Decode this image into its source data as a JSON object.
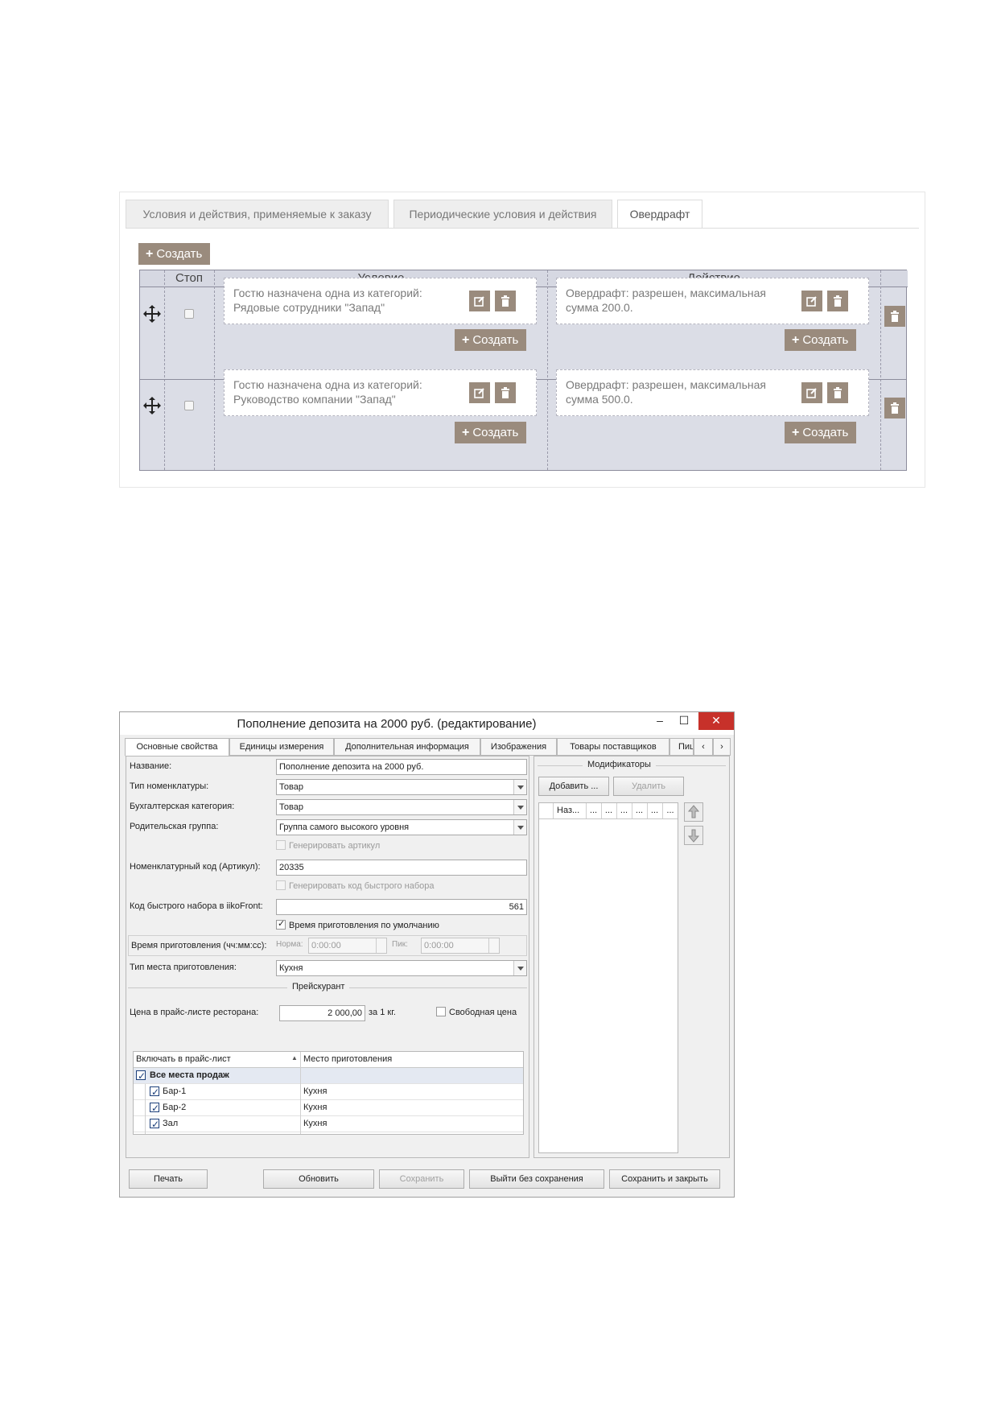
{
  "rules_editor": {
    "tabs": [
      {
        "label": "Условия и действия, применяемые к заказу"
      },
      {
        "label": "Периодические условия и действия"
      },
      {
        "label": "Овердрафт"
      }
    ],
    "create_label": "Создать",
    "columns": {
      "stop": "Стоп",
      "condition": "Условие",
      "action": "Действие"
    },
    "rows": [
      {
        "condition": "Гостю назначена одна из категорий: Рядовые сотрудники \"Запад\"",
        "action": "Овердрафт: разрешен, максимальная сумма 200.0.",
        "stop": false
      },
      {
        "condition": "Гостю назначена одна из категорий: Руководство компании \"Запад\"",
        "action": "Овердрафт: разрешен, максимальная сумма 500.0.",
        "stop": false
      }
    ],
    "colors": {
      "button": "#9a8b7d",
      "grid_bg": "#dbdde6"
    }
  },
  "product_dialog": {
    "title": "Пополнение депозита на 2000 руб. (редактирование)",
    "window_buttons": {
      "minimize": "–",
      "maximize": "☐",
      "close": "✕"
    },
    "tabs": [
      {
        "label": "Основные свойства"
      },
      {
        "label": "Единицы измерения"
      },
      {
        "label": "Дополнительная информация"
      },
      {
        "label": "Изображения"
      },
      {
        "label": "Товары поставщиков"
      },
      {
        "label": "Пиц"
      }
    ],
    "fields": {
      "name_label": "Название:",
      "name_value": "Пополнение депозита на 2000 руб.",
      "type_label": "Тип номенклатуры:",
      "type_value": "Товар",
      "accounting_label": "Бухгалтерская категория:",
      "accounting_value": "Товар",
      "parent_label": "Родительская группа:",
      "parent_value": "Группа самого высокого уровня",
      "gen_sku_label": "Генерировать артикул",
      "sku_label": "Номенклатурный код (Артикул):",
      "sku_value": "20335",
      "gen_quick_label": "Генерировать код быстрого набора",
      "quick_label": "Код быстрого набора в iikoFront:",
      "quick_value": "561",
      "default_time_label": "Время приготовления по умолчанию",
      "cook_time_label": "Время приготовления (чч:мм:сс):",
      "norm_label": "Норма:",
      "norm_value": "0:00:00",
      "peak_label": "Пик:",
      "peak_value": "0:00:00",
      "place_type_label": "Тип места приготовления:",
      "place_type_value": "Кухня"
    },
    "pricelist": {
      "group_title": "Прейскурант",
      "price_label": "Цена в прайс-листе ресторана:",
      "price_value": "2 000,00",
      "unit_label": "за 1 кг.",
      "free_price_label": "Свободная цена",
      "col_include": "Включать в прайс-лист",
      "col_place": "Место приготовления",
      "rows": [
        {
          "name": "Все места продаж",
          "place": "",
          "checked": true,
          "bold": true
        },
        {
          "name": "Бар-1",
          "place": "Кухня",
          "checked": true
        },
        {
          "name": "Бар-2",
          "place": "Кухня",
          "checked": true
        },
        {
          "name": "Зал",
          "place": "Кухня",
          "checked": true
        }
      ]
    },
    "modifiers": {
      "group_title": "Модификаторы",
      "add_label": "Добавить ...",
      "remove_label": "Удалить",
      "col_name": "Наз...",
      "col_more": "..."
    },
    "buttons": {
      "print": "Печать",
      "refresh": "Обновить",
      "save": "Сохранить",
      "exit_no_save": "Выйти без сохранения",
      "save_close": "Сохранить и закрыть"
    }
  }
}
